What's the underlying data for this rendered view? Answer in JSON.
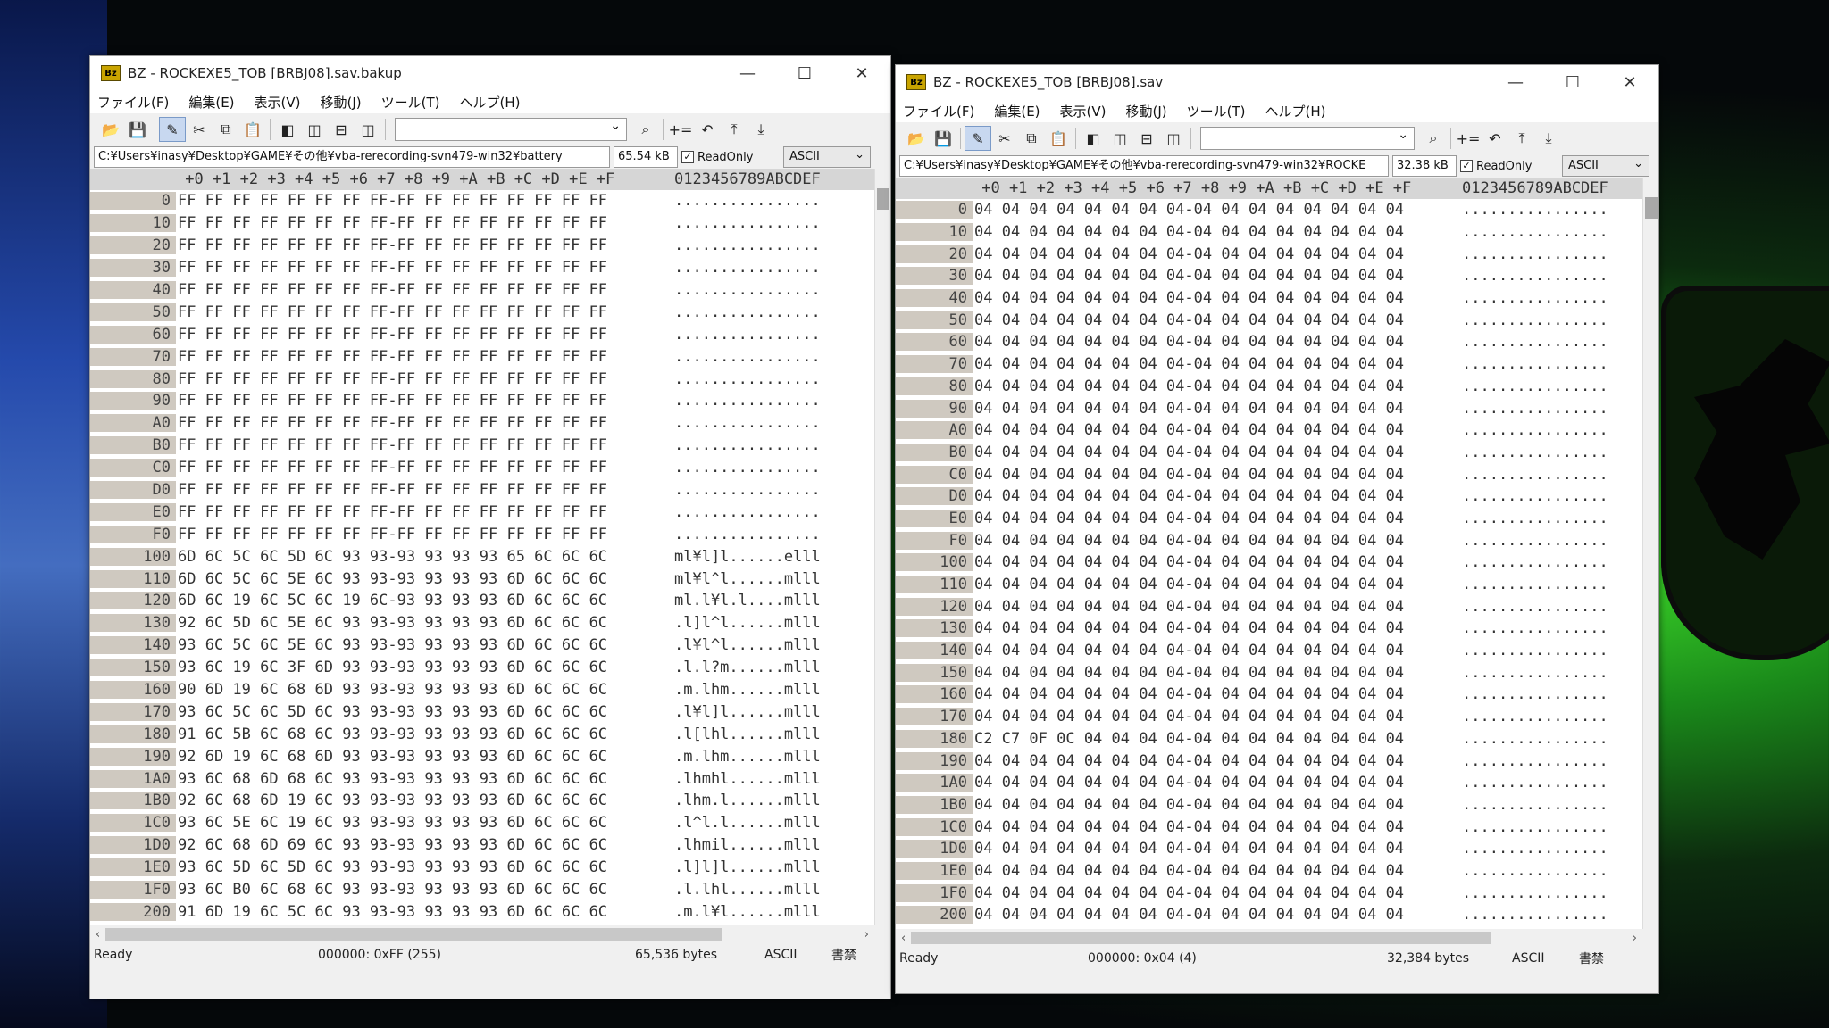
{
  "left": {
    "title": "BZ - ROCKEXE5_TOB [BRBJ08].sav.bakup",
    "icon_text": "Bz",
    "menu": [
      "ファイル(F)",
      "編集(E)",
      "表示(V)",
      "移動(J)",
      "ツール(T)",
      "ヘルプ(H)"
    ],
    "path": "C:¥Users¥inasy¥Desktop¥GAME¥その他¥vba-rerecording-svn479-win32¥battery",
    "size": "65.54 kB",
    "readonly": "ReadOnly",
    "encoding": "ASCII",
    "header": " +0 +1 +2 +3 +4 +5 +6 +7 +8 +9 +A +B +C +D +E +F",
    "ascii_header": "0123456789ABCDEF",
    "rows": [
      {
        "a": "0",
        "h": "FF FF FF FF FF FF FF FF-FF FF FF FF FF FF FF FF",
        "t": "................"
      },
      {
        "a": "10",
        "h": "FF FF FF FF FF FF FF FF-FF FF FF FF FF FF FF FF",
        "t": "................"
      },
      {
        "a": "20",
        "h": "FF FF FF FF FF FF FF FF-FF FF FF FF FF FF FF FF",
        "t": "................"
      },
      {
        "a": "30",
        "h": "FF FF FF FF FF FF FF FF-FF FF FF FF FF FF FF FF",
        "t": "................"
      },
      {
        "a": "40",
        "h": "FF FF FF FF FF FF FF FF-FF FF FF FF FF FF FF FF",
        "t": "................"
      },
      {
        "a": "50",
        "h": "FF FF FF FF FF FF FF FF-FF FF FF FF FF FF FF FF",
        "t": "................"
      },
      {
        "a": "60",
        "h": "FF FF FF FF FF FF FF FF-FF FF FF FF FF FF FF FF",
        "t": "................"
      },
      {
        "a": "70",
        "h": "FF FF FF FF FF FF FF FF-FF FF FF FF FF FF FF FF",
        "t": "................"
      },
      {
        "a": "80",
        "h": "FF FF FF FF FF FF FF FF-FF FF FF FF FF FF FF FF",
        "t": "................"
      },
      {
        "a": "90",
        "h": "FF FF FF FF FF FF FF FF-FF FF FF FF FF FF FF FF",
        "t": "................"
      },
      {
        "a": "A0",
        "h": "FF FF FF FF FF FF FF FF-FF FF FF FF FF FF FF FF",
        "t": "................"
      },
      {
        "a": "B0",
        "h": "FF FF FF FF FF FF FF FF-FF FF FF FF FF FF FF FF",
        "t": "................"
      },
      {
        "a": "C0",
        "h": "FF FF FF FF FF FF FF FF-FF FF FF FF FF FF FF FF",
        "t": "................"
      },
      {
        "a": "D0",
        "h": "FF FF FF FF FF FF FF FF-FF FF FF FF FF FF FF FF",
        "t": "................"
      },
      {
        "a": "E0",
        "h": "FF FF FF FF FF FF FF FF-FF FF FF FF FF FF FF FF",
        "t": "................"
      },
      {
        "a": "F0",
        "h": "FF FF FF FF FF FF FF FF-FF FF FF FF FF FF FF FF",
        "t": "................"
      },
      {
        "a": "100",
        "h": "6D 6C 5C 6C 5D 6C 93 93-93 93 93 93 65 6C 6C 6C",
        "t": "ml¥l]l......elll"
      },
      {
        "a": "110",
        "h": "6D 6C 5C 6C 5E 6C 93 93-93 93 93 93 6D 6C 6C 6C",
        "t": "ml¥l^l......mlll"
      },
      {
        "a": "120",
        "h": "6D 6C 19 6C 5C 6C 19 6C-93 93 93 93 6D 6C 6C 6C",
        "t": "ml.l¥l.l....mlll"
      },
      {
        "a": "130",
        "h": "92 6C 5D 6C 5E 6C 93 93-93 93 93 93 6D 6C 6C 6C",
        "t": ".l]l^l......mlll"
      },
      {
        "a": "140",
        "h": "93 6C 5C 6C 5E 6C 93 93-93 93 93 93 6D 6C 6C 6C",
        "t": ".l¥l^l......mlll"
      },
      {
        "a": "150",
        "h": "93 6C 19 6C 3F 6D 93 93-93 93 93 93 6D 6C 6C 6C",
        "t": ".l.l?m......mlll"
      },
      {
        "a": "160",
        "h": "90 6D 19 6C 68 6D 93 93-93 93 93 93 6D 6C 6C 6C",
        "t": ".m.lhm......mlll"
      },
      {
        "a": "170",
        "h": "93 6C 5C 6C 5D 6C 93 93-93 93 93 93 6D 6C 6C 6C",
        "t": ".l¥l]l......mlll"
      },
      {
        "a": "180",
        "h": "91 6C 5B 6C 68 6C 93 93-93 93 93 93 6D 6C 6C 6C",
        "t": ".l[lhl......mlll"
      },
      {
        "a": "190",
        "h": "92 6D 19 6C 68 6D 93 93-93 93 93 93 6D 6C 6C 6C",
        "t": ".m.lhm......mlll"
      },
      {
        "a": "1A0",
        "h": "93 6C 68 6D 68 6C 93 93-93 93 93 93 6D 6C 6C 6C",
        "t": ".lhmhl......mlll"
      },
      {
        "a": "1B0",
        "h": "92 6C 68 6D 19 6C 93 93-93 93 93 93 6D 6C 6C 6C",
        "t": ".lhm.l......mlll"
      },
      {
        "a": "1C0",
        "h": "93 6C 5E 6C 19 6C 93 93-93 93 93 93 6D 6C 6C 6C",
        "t": ".l^l.l......mlll"
      },
      {
        "a": "1D0",
        "h": "92 6C 68 6D 69 6C 93 93-93 93 93 93 6D 6C 6C 6C",
        "t": ".lhmil......mlll"
      },
      {
        "a": "1E0",
        "h": "93 6C 5D 6C 5D 6C 93 93-93 93 93 93 6D 6C 6C 6C",
        "t": ".l]l]l......mlll"
      },
      {
        "a": "1F0",
        "h": "93 6C B0 6C 68 6C 93 93-93 93 93 93 6D 6C 6C 6C",
        "t": ".l.lhl......mlll"
      },
      {
        "a": "200",
        "h": "91 6D 19 6C 5C 6C 93 93-93 93 93 93 6D 6C 6C 6C",
        "t": ".m.l¥l......mlll"
      }
    ],
    "status": {
      "ready": "Ready",
      "pos": "000000: 0xFF (255)",
      "bytes": "65,536 bytes",
      "enc": "ASCII",
      "mode": "書禁"
    }
  },
  "right": {
    "title": "BZ - ROCKEXE5_TOB [BRBJ08].sav",
    "icon_text": "Bz",
    "menu": [
      "ファイル(F)",
      "編集(E)",
      "表示(V)",
      "移動(J)",
      "ツール(T)",
      "ヘルプ(H)"
    ],
    "path": "C:¥Users¥inasy¥Desktop¥GAME¥その他¥vba-rerecording-svn479-win32¥ROCKE",
    "size": "32.38 kB",
    "readonly": "ReadOnly",
    "encoding": "ASCII",
    "header": " +0 +1 +2 +3 +4 +5 +6 +7 +8 +9 +A +B +C +D +E +F",
    "ascii_header": "0123456789ABCDEF",
    "rows": [
      {
        "a": "0",
        "h": "04 04 04 04 04 04 04 04-04 04 04 04 04 04 04 04",
        "t": "................"
      },
      {
        "a": "10",
        "h": "04 04 04 04 04 04 04 04-04 04 04 04 04 04 04 04",
        "t": "................"
      },
      {
        "a": "20",
        "h": "04 04 04 04 04 04 04 04-04 04 04 04 04 04 04 04",
        "t": "................"
      },
      {
        "a": "30",
        "h": "04 04 04 04 04 04 04 04-04 04 04 04 04 04 04 04",
        "t": "................"
      },
      {
        "a": "40",
        "h": "04 04 04 04 04 04 04 04-04 04 04 04 04 04 04 04",
        "t": "................"
      },
      {
        "a": "50",
        "h": "04 04 04 04 04 04 04 04-04 04 04 04 04 04 04 04",
        "t": "................"
      },
      {
        "a": "60",
        "h": "04 04 04 04 04 04 04 04-04 04 04 04 04 04 04 04",
        "t": "................"
      },
      {
        "a": "70",
        "h": "04 04 04 04 04 04 04 04-04 04 04 04 04 04 04 04",
        "t": "................"
      },
      {
        "a": "80",
        "h": "04 04 04 04 04 04 04 04-04 04 04 04 04 04 04 04",
        "t": "................"
      },
      {
        "a": "90",
        "h": "04 04 04 04 04 04 04 04-04 04 04 04 04 04 04 04",
        "t": "................"
      },
      {
        "a": "A0",
        "h": "04 04 04 04 04 04 04 04-04 04 04 04 04 04 04 04",
        "t": "................"
      },
      {
        "a": "B0",
        "h": "04 04 04 04 04 04 04 04-04 04 04 04 04 04 04 04",
        "t": "................"
      },
      {
        "a": "C0",
        "h": "04 04 04 04 04 04 04 04-04 04 04 04 04 04 04 04",
        "t": "................"
      },
      {
        "a": "D0",
        "h": "04 04 04 04 04 04 04 04-04 04 04 04 04 04 04 04",
        "t": "................"
      },
      {
        "a": "E0",
        "h": "04 04 04 04 04 04 04 04-04 04 04 04 04 04 04 04",
        "t": "................"
      },
      {
        "a": "F0",
        "h": "04 04 04 04 04 04 04 04-04 04 04 04 04 04 04 04",
        "t": "................"
      },
      {
        "a": "100",
        "h": "04 04 04 04 04 04 04 04-04 04 04 04 04 04 04 04",
        "t": "................"
      },
      {
        "a": "110",
        "h": "04 04 04 04 04 04 04 04-04 04 04 04 04 04 04 04",
        "t": "................"
      },
      {
        "a": "120",
        "h": "04 04 04 04 04 04 04 04-04 04 04 04 04 04 04 04",
        "t": "................"
      },
      {
        "a": "130",
        "h": "04 04 04 04 04 04 04 04-04 04 04 04 04 04 04 04",
        "t": "................"
      },
      {
        "a": "140",
        "h": "04 04 04 04 04 04 04 04-04 04 04 04 04 04 04 04",
        "t": "................"
      },
      {
        "a": "150",
        "h": "04 04 04 04 04 04 04 04-04 04 04 04 04 04 04 04",
        "t": "................"
      },
      {
        "a": "160",
        "h": "04 04 04 04 04 04 04 04-04 04 04 04 04 04 04 04",
        "t": "................"
      },
      {
        "a": "170",
        "h": "04 04 04 04 04 04 04 04-04 04 04 04 04 04 04 04",
        "t": "................"
      },
      {
        "a": "180",
        "h": "C2 C7 0F 0C 04 04 04 04-04 04 04 04 04 04 04 04",
        "t": "................"
      },
      {
        "a": "190",
        "h": "04 04 04 04 04 04 04 04-04 04 04 04 04 04 04 04",
        "t": "................"
      },
      {
        "a": "1A0",
        "h": "04 04 04 04 04 04 04 04-04 04 04 04 04 04 04 04",
        "t": "................"
      },
      {
        "a": "1B0",
        "h": "04 04 04 04 04 04 04 04-04 04 04 04 04 04 04 04",
        "t": "................"
      },
      {
        "a": "1C0",
        "h": "04 04 04 04 04 04 04 04-04 04 04 04 04 04 04 04",
        "t": "................"
      },
      {
        "a": "1D0",
        "h": "04 04 04 04 04 04 04 04-04 04 04 04 04 04 04 04",
        "t": "................"
      },
      {
        "a": "1E0",
        "h": "04 04 04 04 04 04 04 04-04 04 04 04 04 04 04 04",
        "t": "................"
      },
      {
        "a": "1F0",
        "h": "04 04 04 04 04 04 04 04-04 04 04 04 04 04 04 04",
        "t": "................"
      },
      {
        "a": "200",
        "h": "04 04 04 04 04 04 04 04-04 04 04 04 04 04 04 04",
        "t": "................"
      }
    ],
    "status": {
      "ready": "Ready",
      "pos": "000000: 0x04 (4)",
      "bytes": "32,384 bytes",
      "enc": "ASCII",
      "mode": "書禁"
    }
  }
}
